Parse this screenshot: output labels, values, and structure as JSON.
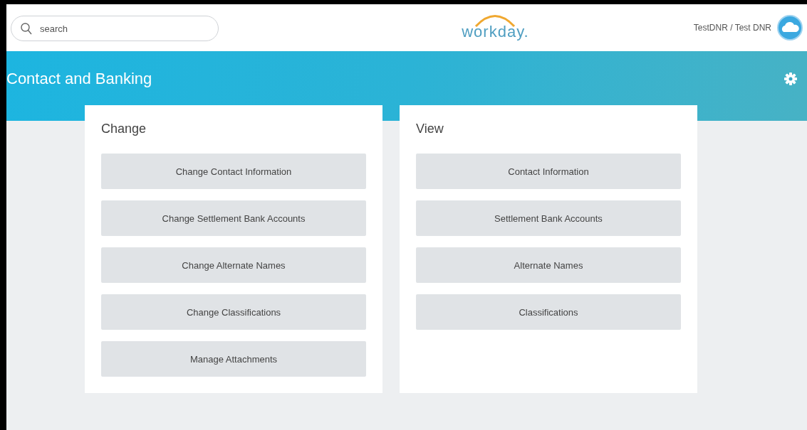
{
  "header": {
    "search": {
      "placeholder": "search"
    },
    "logo": "workday.",
    "user": "TestDNR / Test DNR"
  },
  "banner": {
    "title": "Contact and Banking"
  },
  "cards": [
    {
      "title": "Change",
      "actions": [
        "Change Contact Information",
        "Change Settlement Bank Accounts",
        "Change Alternate Names",
        "Change Classifications",
        "Manage Attachments"
      ]
    },
    {
      "title": "View",
      "actions": [
        "Contact Information",
        "Settlement Bank Accounts",
        "Alternate Names",
        "Classifications"
      ]
    }
  ]
}
